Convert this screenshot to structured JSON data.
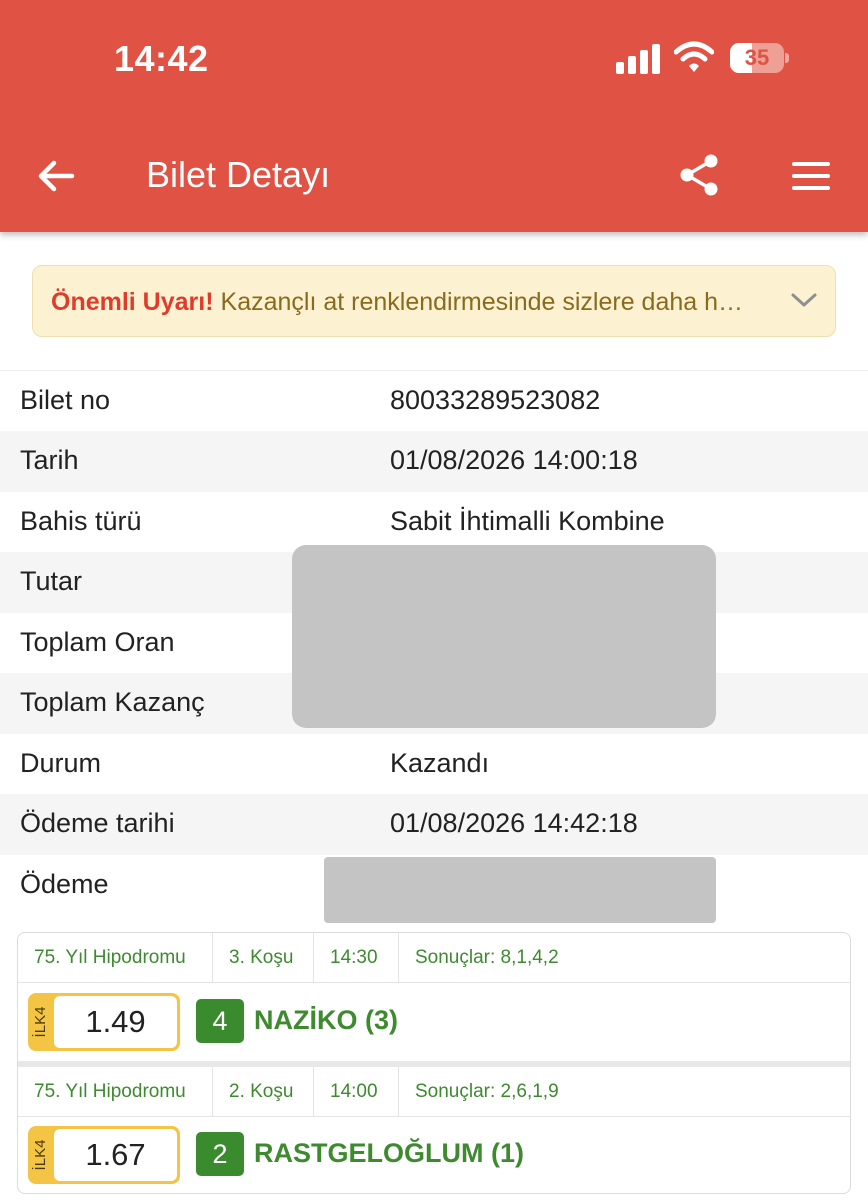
{
  "status_bar": {
    "time": "14:42",
    "battery": "35"
  },
  "app_bar": {
    "title": "Bilet Detayı"
  },
  "warning": {
    "strong": "Önemli Uyarı!",
    "text": "Kazançlı at renklendirmesinde sizlere daha h…"
  },
  "ticket": {
    "rows": [
      {
        "label": "Bilet no",
        "value": "80033289523082"
      },
      {
        "label": "Tarih",
        "value": "01/08/2026 14:00:18"
      },
      {
        "label": "Bahis türü",
        "value": "Sabit İhtimalli Kombine"
      },
      {
        "label": "Tutar",
        "value": ""
      },
      {
        "label": "Toplam Oran",
        "value": ""
      },
      {
        "label": "Toplam Kazanç",
        "value": ""
      },
      {
        "label": "Durum",
        "value": "Kazandı"
      },
      {
        "label": "Ödeme tarihi",
        "value": "01/08/2026 14:42:18"
      },
      {
        "label": "Ödeme",
        "value": ""
      }
    ]
  },
  "bets": [
    {
      "track": "75. Yıl Hipodromu",
      "race": "3. Koşu",
      "time": "14:30",
      "results": "Sonuçlar: 8,1,4,2",
      "tag": "İLK4",
      "odds": "1.49",
      "horse_number": "4",
      "horse_name": "NAZİKO (3)"
    },
    {
      "track": "75. Yıl Hipodromu",
      "race": "2. Koşu",
      "time": "14:00",
      "results": "Sonuçlar: 2,6,1,9",
      "tag": "İLK4",
      "odds": "1.67",
      "horse_number": "2",
      "horse_name": "RASTGELOĞLUM (1)"
    }
  ],
  "colors": {
    "app_bar": "#e05243",
    "warning_bg": "#fcf2d2",
    "warning_strong": "#e03c2b",
    "green_text": "#3d8a2f",
    "horse_badge": "#3a8a2e",
    "odds_tag": "#f4c545",
    "redaction": "#c4c4c4"
  },
  "icons": {
    "back": "arrow-left-icon",
    "share": "share-icon",
    "menu": "hamburger-menu-icon",
    "expand": "chevron-down-icon",
    "signal": "cellular-signal-icon",
    "wifi": "wifi-icon",
    "battery": "battery-icon"
  }
}
